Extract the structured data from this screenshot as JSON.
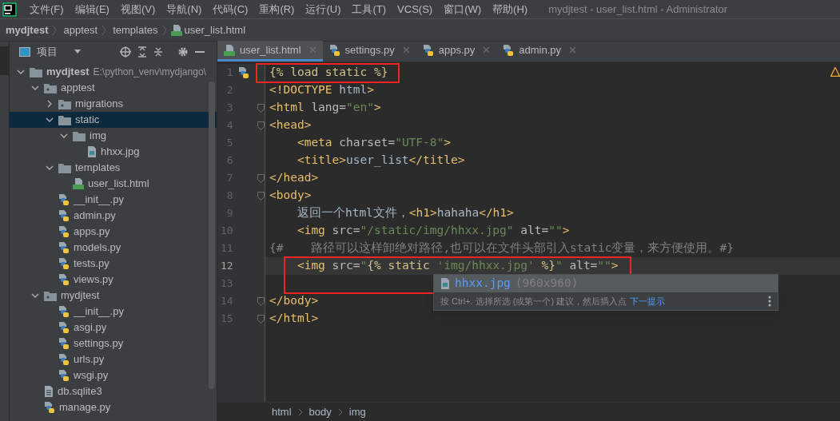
{
  "menu": {
    "items": [
      "文件(F)",
      "编辑(E)",
      "视图(V)",
      "导航(N)",
      "代码(C)",
      "重构(R)",
      "运行(U)",
      "工具(T)",
      "VCS(S)",
      "窗口(W)",
      "帮助(H)"
    ],
    "title": "mydjtest - user_list.html - Administrator"
  },
  "nav_bar": [
    {
      "label": "mydjtest",
      "kind": "project"
    },
    {
      "label": "apptest",
      "kind": "folder"
    },
    {
      "label": "templates",
      "kind": "folder"
    },
    {
      "label": "user_list.html",
      "kind": "html"
    }
  ],
  "project_panel": {
    "title": "项目",
    "tree": [
      {
        "name": "mydjtest",
        "path": "E:\\python_venv\\mydjango\\",
        "kind": "folder",
        "expanded": true,
        "selected": false,
        "children": [
          {
            "name": "apptest",
            "kind": "package",
            "expanded": true,
            "selected": false,
            "children": [
              {
                "name": "migrations",
                "kind": "package",
                "expanded": false,
                "selected": false
              },
              {
                "name": "static",
                "kind": "folder",
                "expanded": true,
                "selected": true,
                "children": [
                  {
                    "name": "img",
                    "kind": "folder",
                    "expanded": true,
                    "selected": false,
                    "children": [
                      {
                        "name": "hhxx.jpg",
                        "kind": "image",
                        "selected": false
                      }
                    ]
                  }
                ]
              },
              {
                "name": "templates",
                "kind": "folder",
                "expanded": true,
                "selected": false,
                "children": [
                  {
                    "name": "user_list.html",
                    "kind": "html",
                    "selected": false
                  }
                ]
              },
              {
                "name": "__init__.py",
                "kind": "py",
                "selected": false
              },
              {
                "name": "admin.py",
                "kind": "py",
                "selected": false
              },
              {
                "name": "apps.py",
                "kind": "py",
                "selected": false
              },
              {
                "name": "models.py",
                "kind": "py",
                "selected": false
              },
              {
                "name": "tests.py",
                "kind": "py",
                "selected": false
              },
              {
                "name": "views.py",
                "kind": "py",
                "selected": false
              }
            ]
          },
          {
            "name": "mydjtest",
            "kind": "package",
            "expanded": true,
            "selected": false,
            "children": [
              {
                "name": "__init__.py",
                "kind": "py",
                "selected": false
              },
              {
                "name": "asgi.py",
                "kind": "py",
                "selected": false
              },
              {
                "name": "settings.py",
                "kind": "py",
                "selected": false
              },
              {
                "name": "urls.py",
                "kind": "py",
                "selected": false
              },
              {
                "name": "wsgi.py",
                "kind": "py",
                "selected": false
              }
            ]
          },
          {
            "name": "db.sqlite3",
            "kind": "file",
            "selected": false
          },
          {
            "name": "manage.py",
            "kind": "py",
            "selected": false
          }
        ]
      }
    ]
  },
  "tabs": [
    {
      "label": "user_list.html",
      "kind": "html",
      "selected": true
    },
    {
      "label": "settings.py",
      "kind": "py",
      "selected": false
    },
    {
      "label": "apps.py",
      "kind": "py",
      "selected": false
    },
    {
      "label": "admin.py",
      "kind": "py",
      "selected": false
    }
  ],
  "editor": {
    "lines": [
      {
        "number": "1",
        "gutter_marker": true,
        "foldable": false,
        "current": false,
        "boxed": true,
        "tokens": [
          {
            "kind": "template",
            "text": "{% load static %}"
          }
        ]
      },
      {
        "number": "2",
        "gutter_marker": false,
        "foldable": false,
        "current": false,
        "boxed": false,
        "tokens": [
          {
            "kind": "tag",
            "text": "<!DOCTYPE "
          },
          {
            "kind": "text",
            "text": "html"
          },
          {
            "kind": "tag",
            "text": ">"
          }
        ]
      },
      {
        "number": "3",
        "gutter_marker": false,
        "foldable": true,
        "current": false,
        "boxed": false,
        "tokens": [
          {
            "kind": "tag",
            "text": "<html "
          },
          {
            "kind": "attr",
            "text": "lang="
          },
          {
            "kind": "string",
            "text": "\"en\""
          },
          {
            "kind": "tag",
            "text": ">"
          }
        ]
      },
      {
        "number": "4",
        "gutter_marker": false,
        "foldable": true,
        "current": false,
        "boxed": false,
        "tokens": [
          {
            "kind": "tag",
            "text": "<head>"
          }
        ]
      },
      {
        "number": "5",
        "gutter_marker": false,
        "foldable": false,
        "current": false,
        "boxed": false,
        "tokens": [
          {
            "kind": "tag",
            "text": "    <meta "
          },
          {
            "kind": "attr",
            "text": "charset="
          },
          {
            "kind": "string",
            "text": "\"UTF-8\""
          },
          {
            "kind": "tag",
            "text": ">"
          }
        ]
      },
      {
        "number": "6",
        "gutter_marker": false,
        "foldable": false,
        "current": false,
        "boxed": false,
        "tokens": [
          {
            "kind": "tag",
            "text": "    <title>"
          },
          {
            "kind": "text",
            "text": "user_list"
          },
          {
            "kind": "tag",
            "text": "</title>"
          }
        ]
      },
      {
        "number": "7",
        "gutter_marker": false,
        "foldable": true,
        "current": false,
        "boxed": false,
        "tokens": [
          {
            "kind": "tag",
            "text": "</head>"
          }
        ]
      },
      {
        "number": "8",
        "gutter_marker": false,
        "foldable": true,
        "current": false,
        "boxed": false,
        "tokens": [
          {
            "kind": "tag",
            "text": "<body>"
          }
        ]
      },
      {
        "number": "9",
        "gutter_marker": false,
        "foldable": false,
        "current": false,
        "boxed": false,
        "tokens": [
          {
            "kind": "text",
            "text": "    返回一个html文件，"
          },
          {
            "kind": "tag",
            "text": "<h1>"
          },
          {
            "kind": "text",
            "text": "hahaha"
          },
          {
            "kind": "tag",
            "text": "</h1>"
          }
        ]
      },
      {
        "number": "10",
        "gutter_marker": false,
        "foldable": false,
        "current": false,
        "boxed": false,
        "tokens": [
          {
            "kind": "tag",
            "text": "    <img "
          },
          {
            "kind": "attr",
            "text": "src="
          },
          {
            "kind": "string",
            "text": "\"/static/img/hhxx.jpg\""
          },
          {
            "kind": "attr",
            "text": " alt="
          },
          {
            "kind": "string",
            "text": "\"\""
          },
          {
            "kind": "tag",
            "text": ">"
          }
        ]
      },
      {
        "number": "11",
        "gutter_marker": false,
        "foldable": false,
        "current": false,
        "boxed": false,
        "tokens": [
          {
            "kind": "comment",
            "text": "{#    路径可以这样卸绝对路径,也可以在文件头部引入static变量，来方便使用。#}"
          }
        ]
      },
      {
        "number": "12",
        "gutter_marker": false,
        "foldable": false,
        "current": true,
        "boxed": true,
        "tokens": [
          {
            "kind": "tag",
            "text": "    <img "
          },
          {
            "kind": "attr",
            "text": "src="
          },
          {
            "kind": "string",
            "text": "\""
          },
          {
            "kind": "template",
            "text": "{% static "
          },
          {
            "kind": "string",
            "text": "'img/hhxx.jpg'"
          },
          {
            "kind": "template",
            "text": " %}"
          },
          {
            "kind": "string",
            "text": "\""
          },
          {
            "kind": "attr",
            "text": " alt="
          },
          {
            "kind": "string",
            "text": "\"\""
          },
          {
            "kind": "tag",
            "text": ">"
          }
        ]
      },
      {
        "number": "13",
        "gutter_marker": false,
        "foldable": false,
        "current": false,
        "boxed": true
      },
      {
        "number": "14",
        "gutter_marker": false,
        "foldable": true,
        "current": false,
        "boxed": false,
        "tokens": [
          {
            "kind": "tag",
            "text": "</body>"
          }
        ]
      },
      {
        "number": "15",
        "gutter_marker": false,
        "foldable": true,
        "current": false,
        "boxed": false,
        "tokens": [
          {
            "kind": "tag",
            "text": "</html>"
          }
        ]
      }
    ],
    "completion": {
      "items": [
        {
          "name": "hhxx.jpg",
          "detail": "(960x960)",
          "selected": true
        }
      ],
      "hint": "按 Ctrl+. 选择所选 (或第一个) 建议，然后插入点",
      "hint_link": "下一提示"
    }
  },
  "breadcrumb": [
    "html",
    "body",
    "img"
  ]
}
